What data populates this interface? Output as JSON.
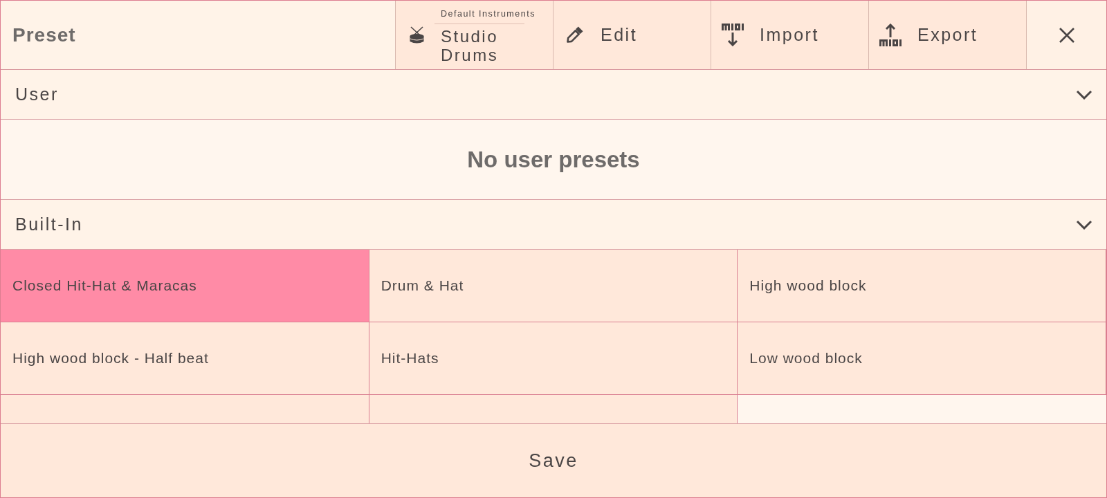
{
  "header": {
    "title": "Preset",
    "instrument": {
      "caption": "Default Instruments",
      "name": "Studio Drums"
    },
    "actions": [
      {
        "kind": "edit",
        "label": "Edit"
      },
      {
        "kind": "import",
        "label": "Import"
      },
      {
        "kind": "export",
        "label": "Export"
      }
    ]
  },
  "sections": [
    {
      "kind": "empty",
      "title": "User",
      "expanded": true,
      "message": "No user presets"
    },
    {
      "kind": "grid",
      "title": "Built-In",
      "expanded": true,
      "more_below": true,
      "presets": [
        {
          "label": "Closed Hit-Hat & Maracas",
          "selected": true
        },
        {
          "label": "Drum & Hat",
          "selected": false
        },
        {
          "label": "High wood block",
          "selected": false
        },
        {
          "label": "High wood block - Half beat",
          "selected": false
        },
        {
          "label": "Hit-Hats",
          "selected": false
        },
        {
          "label": "Low wood block",
          "selected": false
        }
      ]
    }
  ],
  "footer": {
    "save": "Save"
  }
}
